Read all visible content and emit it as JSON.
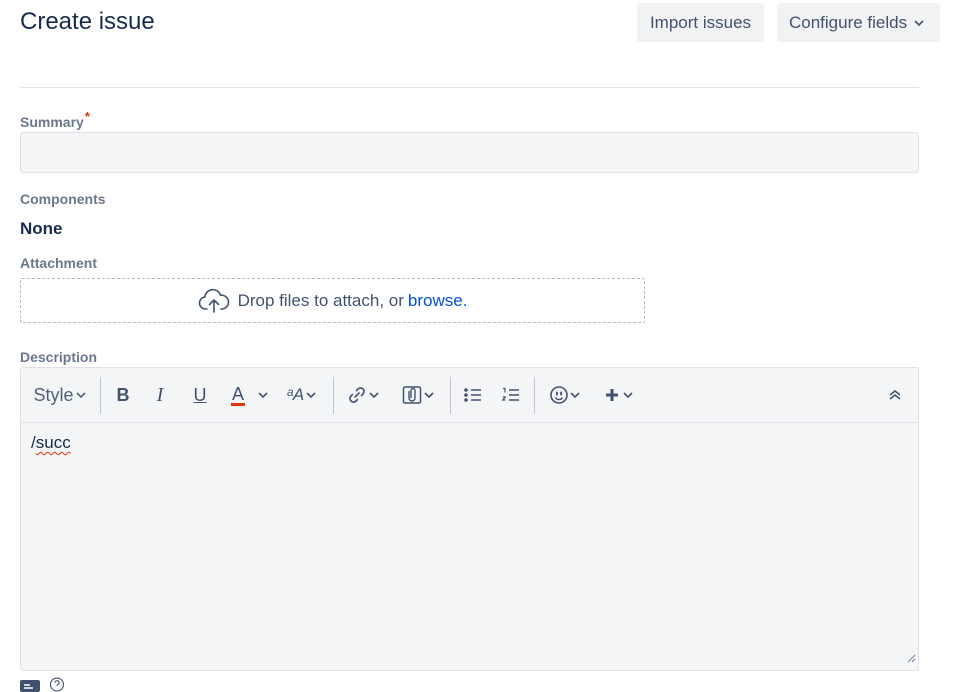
{
  "header": {
    "title": "Create issue",
    "import_label": "Import issues",
    "configure_label": "Configure fields"
  },
  "summary": {
    "label": "Summary",
    "required_mark": "*",
    "value": "",
    "placeholder": ""
  },
  "components": {
    "label": "Components",
    "value": "None"
  },
  "attachment": {
    "label": "Attachment",
    "drop_text": "Drop files to attach, or",
    "browse_text": "browse."
  },
  "description": {
    "label": "Description",
    "toolbar": {
      "style_label": "Style",
      "bold_label": "B",
      "italic_label": "I",
      "underline_label": "U",
      "color_label": "A",
      "text_size_label": "ᵃA"
    },
    "content_prefix": "/",
    "content_word": "succ"
  },
  "colors": {
    "accent": "#0052cc",
    "required": "#de350b",
    "text_color_underline": "#de350b"
  },
  "icons": [
    "chevron-down-icon",
    "cloud-upload-icon",
    "link-icon",
    "attachment-icon",
    "bullet-list-icon",
    "numbered-list-icon",
    "emoji-icon",
    "plus-icon",
    "collapse-icon",
    "resize-handle-icon",
    "help-icon"
  ]
}
